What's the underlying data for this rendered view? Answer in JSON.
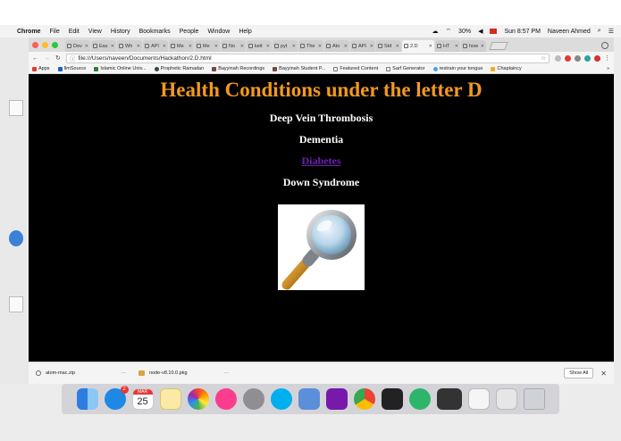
{
  "menubar": {
    "app_name": "Chrome",
    "items": [
      "File",
      "Edit",
      "View",
      "History",
      "Bookmarks",
      "People",
      "Window",
      "Help"
    ],
    "battery": "30%",
    "datetime": "Sun 8:57 PM",
    "user": "Naveen Ahmed"
  },
  "browser": {
    "tabs": [
      {
        "label": "Dev"
      },
      {
        "label": "Eas"
      },
      {
        "label": "Wh"
      },
      {
        "label": "API"
      },
      {
        "label": "Me"
      },
      {
        "label": "Me"
      },
      {
        "label": "No"
      },
      {
        "label": "keit"
      },
      {
        "label": "pyt"
      },
      {
        "label": "The"
      },
      {
        "label": "Ato"
      },
      {
        "label": "API"
      },
      {
        "label": "Std"
      },
      {
        "label": "2.D",
        "active": true
      },
      {
        "label": "HT"
      },
      {
        "label": "how"
      }
    ],
    "address": "file:///Users/naveen/Documents/Hackathon/2.D.html",
    "bookmarks": [
      "Apps",
      "IlmSource",
      "Islamic Online Univ...",
      "Prophetic Ramadan",
      "Bayyinah Recordings",
      "Bayyinah Student P...",
      "Featured Content",
      "Sarf Generator",
      "restrain your tongue",
      "Chaplaincy"
    ],
    "bookmarks_overflow": "»"
  },
  "page": {
    "title": "Health Conditions under the letter D",
    "conditions": [
      {
        "label": "Deep Vein Thrombosis",
        "link": false
      },
      {
        "label": "Dementia",
        "link": false
      },
      {
        "label": "Diabetes",
        "link": true
      },
      {
        "label": "Down Syndrome",
        "link": false
      }
    ],
    "image_icon": "magnifying-glass"
  },
  "downloads": {
    "items": [
      {
        "name": "atom-mac.zip"
      },
      {
        "name": "node-v8.10.0.pkg"
      }
    ],
    "show_all": "Show All",
    "close": "✕"
  },
  "dock": {
    "calendar_day": "25",
    "calendar_month": "MAR",
    "app_store_badge": "2"
  }
}
